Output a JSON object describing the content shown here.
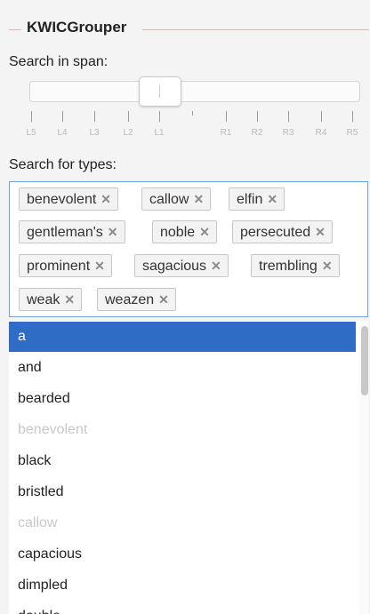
{
  "app": {
    "legend": "KWICGrouper"
  },
  "span": {
    "label": "Search in span:",
    "ticks": [
      "L5",
      "L4",
      "L3",
      "L2",
      "L1",
      "R1",
      "R2",
      "R3",
      "R4",
      "R5"
    ]
  },
  "types": {
    "label": "Search for types:",
    "selected": [
      "benevolent",
      "callow",
      "elfin",
      "gentleman's",
      "noble",
      "persecuted",
      "prominent",
      "sagacious",
      "trembling",
      "weak",
      "weazen"
    ],
    "remove_glyph": "✕"
  },
  "list": {
    "items": [
      {
        "text": "a",
        "state": "selected"
      },
      {
        "text": "and",
        "state": "normal"
      },
      {
        "text": "bearded",
        "state": "normal"
      },
      {
        "text": "benevolent",
        "state": "disabled"
      },
      {
        "text": "black",
        "state": "normal"
      },
      {
        "text": "bristled",
        "state": "normal"
      },
      {
        "text": "callow",
        "state": "disabled"
      },
      {
        "text": "capacious",
        "state": "normal"
      },
      {
        "text": "dimpled",
        "state": "normal"
      },
      {
        "text": "double",
        "state": "normal"
      }
    ]
  },
  "colors": {
    "selection": "#2e6cc6",
    "focus_border": "#6fa3d8"
  }
}
